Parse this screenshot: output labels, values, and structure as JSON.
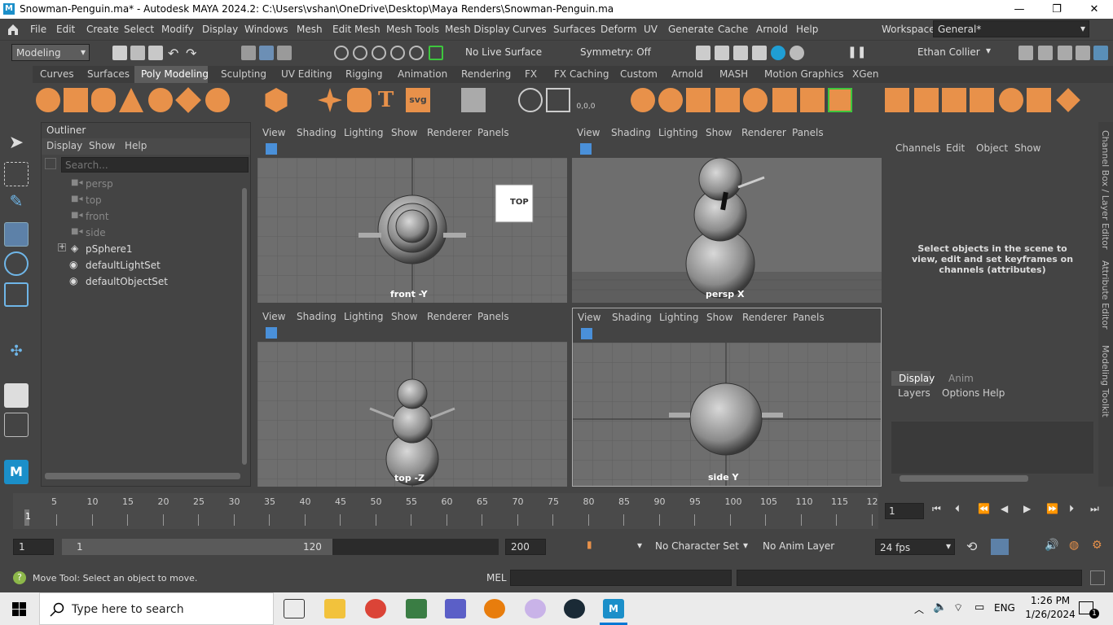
{
  "window": {
    "title": "Snowman-Penguin.ma* - Autodesk MAYA 2024.2: C:\\Users\\vshan\\OneDrive\\Desktop\\Maya Renders\\Snowman-Penguin.ma",
    "icon_text": "M",
    "minimize": "—",
    "restore": "❐",
    "close": "✕"
  },
  "menu": [
    "File",
    "Edit",
    "Create",
    "Select",
    "Modify",
    "Display",
    "Windows",
    "Mesh",
    "Edit Mesh",
    "Mesh Tools",
    "Mesh Display",
    "Curves",
    "Surfaces",
    "Deform",
    "UV",
    "Generate",
    "Cache",
    "Arnold",
    "Help"
  ],
  "workspace": {
    "label": "Workspace:",
    "value": "General*"
  },
  "status": {
    "menuset": "Modeling",
    "live_surface": "No Live Surface",
    "symmetry": "Symmetry: Off",
    "user": "Ethan Collier"
  },
  "shelf": {
    "tabs": [
      "Curves",
      "Surfaces",
      "Poly Modeling",
      "Sculpting",
      "UV Editing",
      "Rigging",
      "Animation",
      "Rendering",
      "FX",
      "FX Caching",
      "Custom",
      "Arnold",
      "MASH",
      "Motion Graphics",
      "XGen"
    ],
    "active": "Poly Modeling",
    "pivot_label": "0,0,0",
    "svg_label": "svg"
  },
  "outliner": {
    "title": "Outliner",
    "menu": [
      "Display",
      "Show",
      "Help"
    ],
    "search_placeholder": "Search...",
    "items": [
      {
        "label": "persp"
      },
      {
        "label": "top"
      },
      {
        "label": "front"
      },
      {
        "label": "side"
      },
      {
        "label": "pSphere1"
      },
      {
        "label": "defaultLightSet"
      },
      {
        "label": "defaultObjectSet"
      }
    ]
  },
  "viewports": {
    "menu": [
      "View",
      "Shading",
      "Lighting",
      "Show",
      "Renderer",
      "Panels"
    ],
    "front": "front -Y",
    "persp": "persp X",
    "top": "top -Z",
    "side": "side Y",
    "viewcube": "TOP"
  },
  "channel_box": {
    "menu": [
      "Channels",
      "Edit",
      "Object",
      "Show"
    ],
    "message": "Select objects in the scene to view, edit and set keyframes on channels (attributes)",
    "layer_tabs": [
      "Display",
      "Anim"
    ],
    "layer_menu": [
      "Layers",
      "Options",
      "Help"
    ]
  },
  "side_tabs": [
    "Channel Box / Layer Editor",
    "Attribute Editor",
    "Modeling Toolkit"
  ],
  "timeline": {
    "ticks": [
      "5",
      "10",
      "15",
      "20",
      "25",
      "30",
      "35",
      "40",
      "45",
      "50",
      "55",
      "60",
      "65",
      "70",
      "75",
      "80",
      "85",
      "90",
      "95",
      "100",
      "105",
      "110",
      "115",
      "12"
    ],
    "current_frame": "1",
    "frame_field": "1"
  },
  "range": {
    "start": "1",
    "inner_start": "1",
    "inner_end": "120",
    "end": "200",
    "character_set": "No Character Set",
    "anim_layer": "No Anim Layer",
    "fps": "24 fps"
  },
  "command": {
    "help": "Move Tool: Select an object to move.",
    "mel": "MEL"
  },
  "taskbar": {
    "search": "Type here to search",
    "lang": "ENG",
    "time": "1:26 PM",
    "date": "1/26/2024",
    "notif": "1"
  }
}
